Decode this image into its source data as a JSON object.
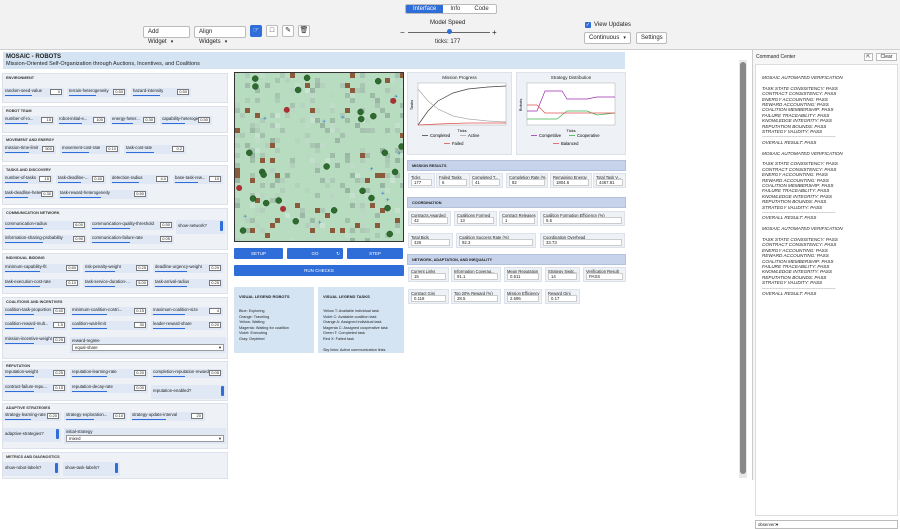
{
  "tabs": [
    "Interface",
    "Info",
    "Code"
  ],
  "toolbar": {
    "add_widget": "Add Widget",
    "align_widgets": "Align Widgets",
    "model_speed_label": "Model Speed",
    "ticks_label": "ticks:",
    "ticks_value": "177",
    "view_updates": "View Updates",
    "update_mode": "Continuous",
    "settings": "Settings",
    "speed_fraction": 0.5
  },
  "model": {
    "title": "MOSAIC - ROBOTS",
    "subtitle": "Mission-Oriented Self-Organization through Auctions, Incentives, and Coalitions"
  },
  "sections": {
    "environment": {
      "title": "ENVIRONMENT",
      "sliders": [
        {
          "label": "random-seed-value",
          "value": "0"
        },
        {
          "label": "terrain-heterogeneity",
          "value": "0.50"
        },
        {
          "label": "hazard-intensity",
          "value": "0.50"
        }
      ]
    },
    "robot_team": {
      "title": "ROBOT TEAM",
      "sliders": [
        {
          "label": "number-of-ro...",
          "value": "15"
        },
        {
          "label": "robot-initial-e...",
          "value": "100"
        },
        {
          "label": "energy-heter...",
          "value": "0.30"
        },
        {
          "label": "capability-heteroge...",
          "value": "0.50"
        }
      ]
    },
    "movement": {
      "title": "MOVEMENT AND ENERGY",
      "sliders": [
        {
          "label": "mission-time-limit",
          "value": "500"
        },
        {
          "label": "movement-cost-rate",
          "value": "0.10"
        },
        {
          "label": "task-cost-rate",
          "value": "0.2"
        }
      ]
    },
    "tasks": {
      "title": "TASKS AND DISCOVERY",
      "sliders": [
        {
          "label": "number-of-tasks",
          "value": "15"
        },
        {
          "label": "task-deadline-...",
          "value": "0.40"
        },
        {
          "label": "detection-radius",
          "value": "4.0"
        },
        {
          "label": "base-task-rew...",
          "value": "10"
        },
        {
          "label": "task-deadline-heterog...",
          "value": "0.30"
        },
        {
          "label": "task-reward-heterogeneity",
          "value": "0.50"
        }
      ]
    },
    "communication": {
      "title": "COMMUNICATION NETWORK",
      "sliders": [
        {
          "label": "communication-radius",
          "value": "6.00"
        },
        {
          "label": "communication-quality-threshold",
          "value": "0.50"
        },
        {
          "label": "information-sharing-probability",
          "value": "0.90"
        },
        {
          "label": "communication-failure-rate",
          "value": "0.05"
        }
      ],
      "switch_label": "show-network?"
    },
    "individual": {
      "title": "INDIVIDUAL BIDDING",
      "sliders": [
        {
          "label": "minimum-capability-fit",
          "value": "0.60"
        },
        {
          "label": "risk-penalty-weight",
          "value": "0.25"
        },
        {
          "label": "deadline-urgency-weight",
          "value": "0.20"
        },
        {
          "label": "task-execution-cost-rate",
          "value": "0.10"
        },
        {
          "label": "task-service-duration-...",
          "value": "5.00"
        },
        {
          "label": "task-arrival-radius",
          "value": "0.25"
        }
      ]
    },
    "coalitions": {
      "title": "COALITIONS AND INCENTIVES",
      "sliders": [
        {
          "label": "coalition-task-proportion",
          "value": "0.40"
        },
        {
          "label": "minimum-coalition-contri...",
          "value": "0.15"
        },
        {
          "label": "maximum-coalition-size",
          "value": "4"
        },
        {
          "label": "coalition-reward-mult...",
          "value": "1.5"
        },
        {
          "label": "coalition-wait-limit",
          "value": "30"
        },
        {
          "label": "leader-reward-share",
          "value": "0.20"
        },
        {
          "label": "mission-incentive-weight",
          "value": "0.25"
        }
      ],
      "chooser_label": "reward-regime",
      "chooser_value": "equal-share"
    },
    "reputation": {
      "title": "REPUTATION",
      "sliders": [
        {
          "label": "reputation-weight",
          "value": "0.25"
        },
        {
          "label": "reputation-learning-rate",
          "value": "0.20"
        },
        {
          "label": "completion-reputation-reward",
          "value": "0.05"
        },
        {
          "label": "contract-failure-repu...",
          "value": "0.15"
        },
        {
          "label": "reputation-decay-rate",
          "value": "0.00"
        }
      ],
      "switch_label": "reputation-enabled?"
    },
    "adaptive": {
      "title": "ADAPTIVE STRATEGIES",
      "sliders": [
        {
          "label": "strategy-learning-rate",
          "value": "0.20"
        },
        {
          "label": "strategy-exploration...",
          "value": "0.10"
        },
        {
          "label": "strategy-update-interval",
          "value": "20"
        }
      ],
      "switch_label": "adaptive-strategies?",
      "chooser_label": "initial-strategy",
      "chooser_value": "mixed"
    },
    "metrics": {
      "title": "METRICS AND DIAGNOSTICS",
      "switches": [
        "show-robot-labels?",
        "show-task-labels?"
      ]
    }
  },
  "buttons": {
    "setup": "SETUP",
    "go": "GO",
    "step": "STEP",
    "run_checks": "RUN CHECKS"
  },
  "legend_robots": {
    "title": "VISUAL LEGEND ROBOTS",
    "lines": [
      "Blue: Exploring",
      "Orange: Traveling",
      "Yellow: Waiting",
      "Magenta: Waiting for coalition",
      "Violet: Executing",
      "Gray: Depleted"
    ]
  },
  "legend_tasks": {
    "title": "VISUAL LEGEND TASKS",
    "lines": [
      "Yellow T: Available individual task",
      "Violet C: Available coalition task",
      "Orange A: Assigned individual task",
      "Magenta C: Assigned cooperative task",
      "Green T: Completed task",
      "Red X: Failed task",
      "",
      "Sky links: Active communication links"
    ]
  },
  "plots": {
    "mission_progress": {
      "title": "Mission Progress",
      "ylabel": "Tasks",
      "xlabel": "Ticks",
      "legend": [
        "Completed",
        "Active",
        "Failed"
      ],
      "colors": [
        "#444444",
        "#aaaaaa",
        "#e05050"
      ]
    },
    "strategy": {
      "title": "Strategy Distribution",
      "ylabel": "Robots",
      "xlabel": "Ticks",
      "legend": [
        "Competitive",
        "Cooperative",
        "Balanced"
      ],
      "colors": [
        "#9b2fae",
        "#3cb44b",
        "#e05050"
      ]
    }
  },
  "mission_results": {
    "title": "MISSION RESULTS",
    "monitors": [
      {
        "label": "Ticks",
        "value": "177"
      },
      {
        "label": "Failed Tasks",
        "value": "6"
      },
      {
        "label": "Completed T...",
        "value": "41"
      },
      {
        "label": "Completion Rate (%)",
        "value": "82"
      },
      {
        "label": "Remaining Energy",
        "value": "1804.6"
      },
      {
        "label": "Total Task V...",
        "value": "4467.81"
      }
    ]
  },
  "coordination": {
    "title": "COORDINATION",
    "monitors": [
      {
        "label": "Contracts Awarded",
        "value": "42"
      },
      {
        "label": "Coalitions Formed",
        "value": "13"
      },
      {
        "label": "Contract Releases",
        "value": "1"
      },
      {
        "label": "Coalition Formation Efficiency (%)",
        "value": "5.5"
      },
      {
        "label": "Total Bids",
        "value": "426"
      },
      {
        "label": "Coalition Success Rate (%)",
        "value": "92.3"
      },
      {
        "label": "Coordination Overhead",
        "value": "33.73"
      }
    ]
  },
  "network": {
    "title": "NETWORK, ADAPTATION, AND INEQUALITY",
    "monitors": [
      {
        "label": "Current Links",
        "value": "15"
      },
      {
        "label": "Information Coverag...",
        "value": "91.1"
      },
      {
        "label": "Mean Reputation",
        "value": "0.511"
      },
      {
        "label": "Strategy Switc...",
        "value": "14"
      },
      {
        "label": "Verification Result",
        "value": "PASS"
      },
      {
        "label": "Contract Gini",
        "value": "0.118"
      },
      {
        "label": "Top 20% Reward (%)",
        "value": "28.5"
      },
      {
        "label": "Mission Efficiency",
        "value": "2.596"
      },
      {
        "label": "Reward Gini",
        "value": "0.17"
      }
    ]
  },
  "command_center": {
    "title": "Command Center",
    "clear": "Clear",
    "observer": "observer>",
    "lines": [
      "MOSAIC AUTOMATED VERIFICATION",
      "",
      "TASK STATE CONSISTENCY: PASS",
      "CONTRACT CONSISTENCY: PASS",
      "ENERGY ACCOUNTING: PASS",
      "REWARD ACCOUNTING: PASS",
      "COALITION MEMBERSHIP: PASS",
      "FAILURE TRACEABILITY: PASS",
      "KNOWLEDGE INTEGRITY: PASS",
      "REPUTATION BOUNDS: PASS",
      "STRATEGY VALIDITY: PASS",
      "------------------------------------------------",
      "OVERALL RESULT: PASS",
      "",
      "MOSAIC AUTOMATED VERIFICATION",
      "",
      "TASK STATE CONSISTENCY: PASS",
      "CONTRACT CONSISTENCY: PASS",
      "ENERGY ACCOUNTING: PASS",
      "REWARD ACCOUNTING: PASS",
      "COALITION MEMBERSHIP: PASS",
      "FAILURE TRACEABILITY: PASS",
      "KNOWLEDGE INTEGRITY: PASS",
      "REPUTATION BOUNDS: PASS",
      "STRATEGY VALIDITY: PASS",
      "------------------------------------------------",
      "OVERALL RESULT: PASS",
      "",
      "MOSAIC AUTOMATED VERIFICATION",
      "",
      "TASK STATE CONSISTENCY: PASS",
      "CONTRACT CONSISTENCY: PASS",
      "ENERGY ACCOUNTING: PASS",
      "REWARD ACCOUNTING: PASS",
      "COALITION MEMBERSHIP: PASS",
      "FAILURE TRACEABILITY: PASS",
      "KNOWLEDGE INTEGRITY: PASS",
      "REPUTATION BOUNDS: PASS",
      "STRATEGY VALIDITY: PASS",
      "------------------------------------------------",
      "OVERALL RESULT: PASS"
    ]
  }
}
